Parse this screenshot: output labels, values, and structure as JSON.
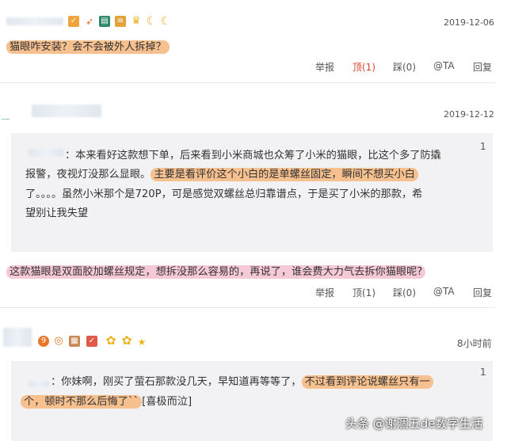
{
  "post1": {
    "date": "2019-12-06",
    "question": "猫眼咋安装？会不会被外人拆掉？",
    "actions": {
      "report": "举报",
      "up": "顶(1)",
      "down": "踩(0)",
      "at": "@TA",
      "reply": "回复"
    }
  },
  "post2": {
    "date": "2019-12-12",
    "quote_num": "1",
    "quote_line1": "：本来看好这款想下单，后来看到小米商城也众筹了小米的猫眼，比这个多了防撬",
    "quote_line2a": "报警，夜视灯没那么显眼。",
    "quote_line2b": "主要是看评价这个小白的是单螺丝固定，瞬间不想买小白",
    "quote_line3": "了。。。。虽然小米那个是720P，可是感觉双螺丝总归靠谱点，于是买了小米的那款，希",
    "quote_line4": "望别让我失望",
    "reply": "这款猫眼是双面胶加螺丝规定，想拆没那么容易的，再说了，谁会费大力气去拆你猫眼呢?",
    "actions": {
      "report": "举报",
      "up": "顶(1)",
      "down": "踩(0)",
      "at": "@TA",
      "reply": "回复"
    }
  },
  "post3": {
    "time": "8小时前",
    "quote_num": "1",
    "quote_line1a": "：你妹啊，刚买了萤石那款没几天，早知道再等等了，",
    "quote_line1b": "不过看到评论说螺丝只有一",
    "quote_line2a": "个，顿时不那么后悔了``",
    "quote_line2b": "[喜极而泣]"
  },
  "watermark": "头条 @谢涸五de数字生活",
  "colors": {
    "highlight_orange": "#f7c08f",
    "highlight_pink": "#f6c9d6",
    "quote_bg": "#f2f2f4",
    "up_active": "#d9452f"
  }
}
